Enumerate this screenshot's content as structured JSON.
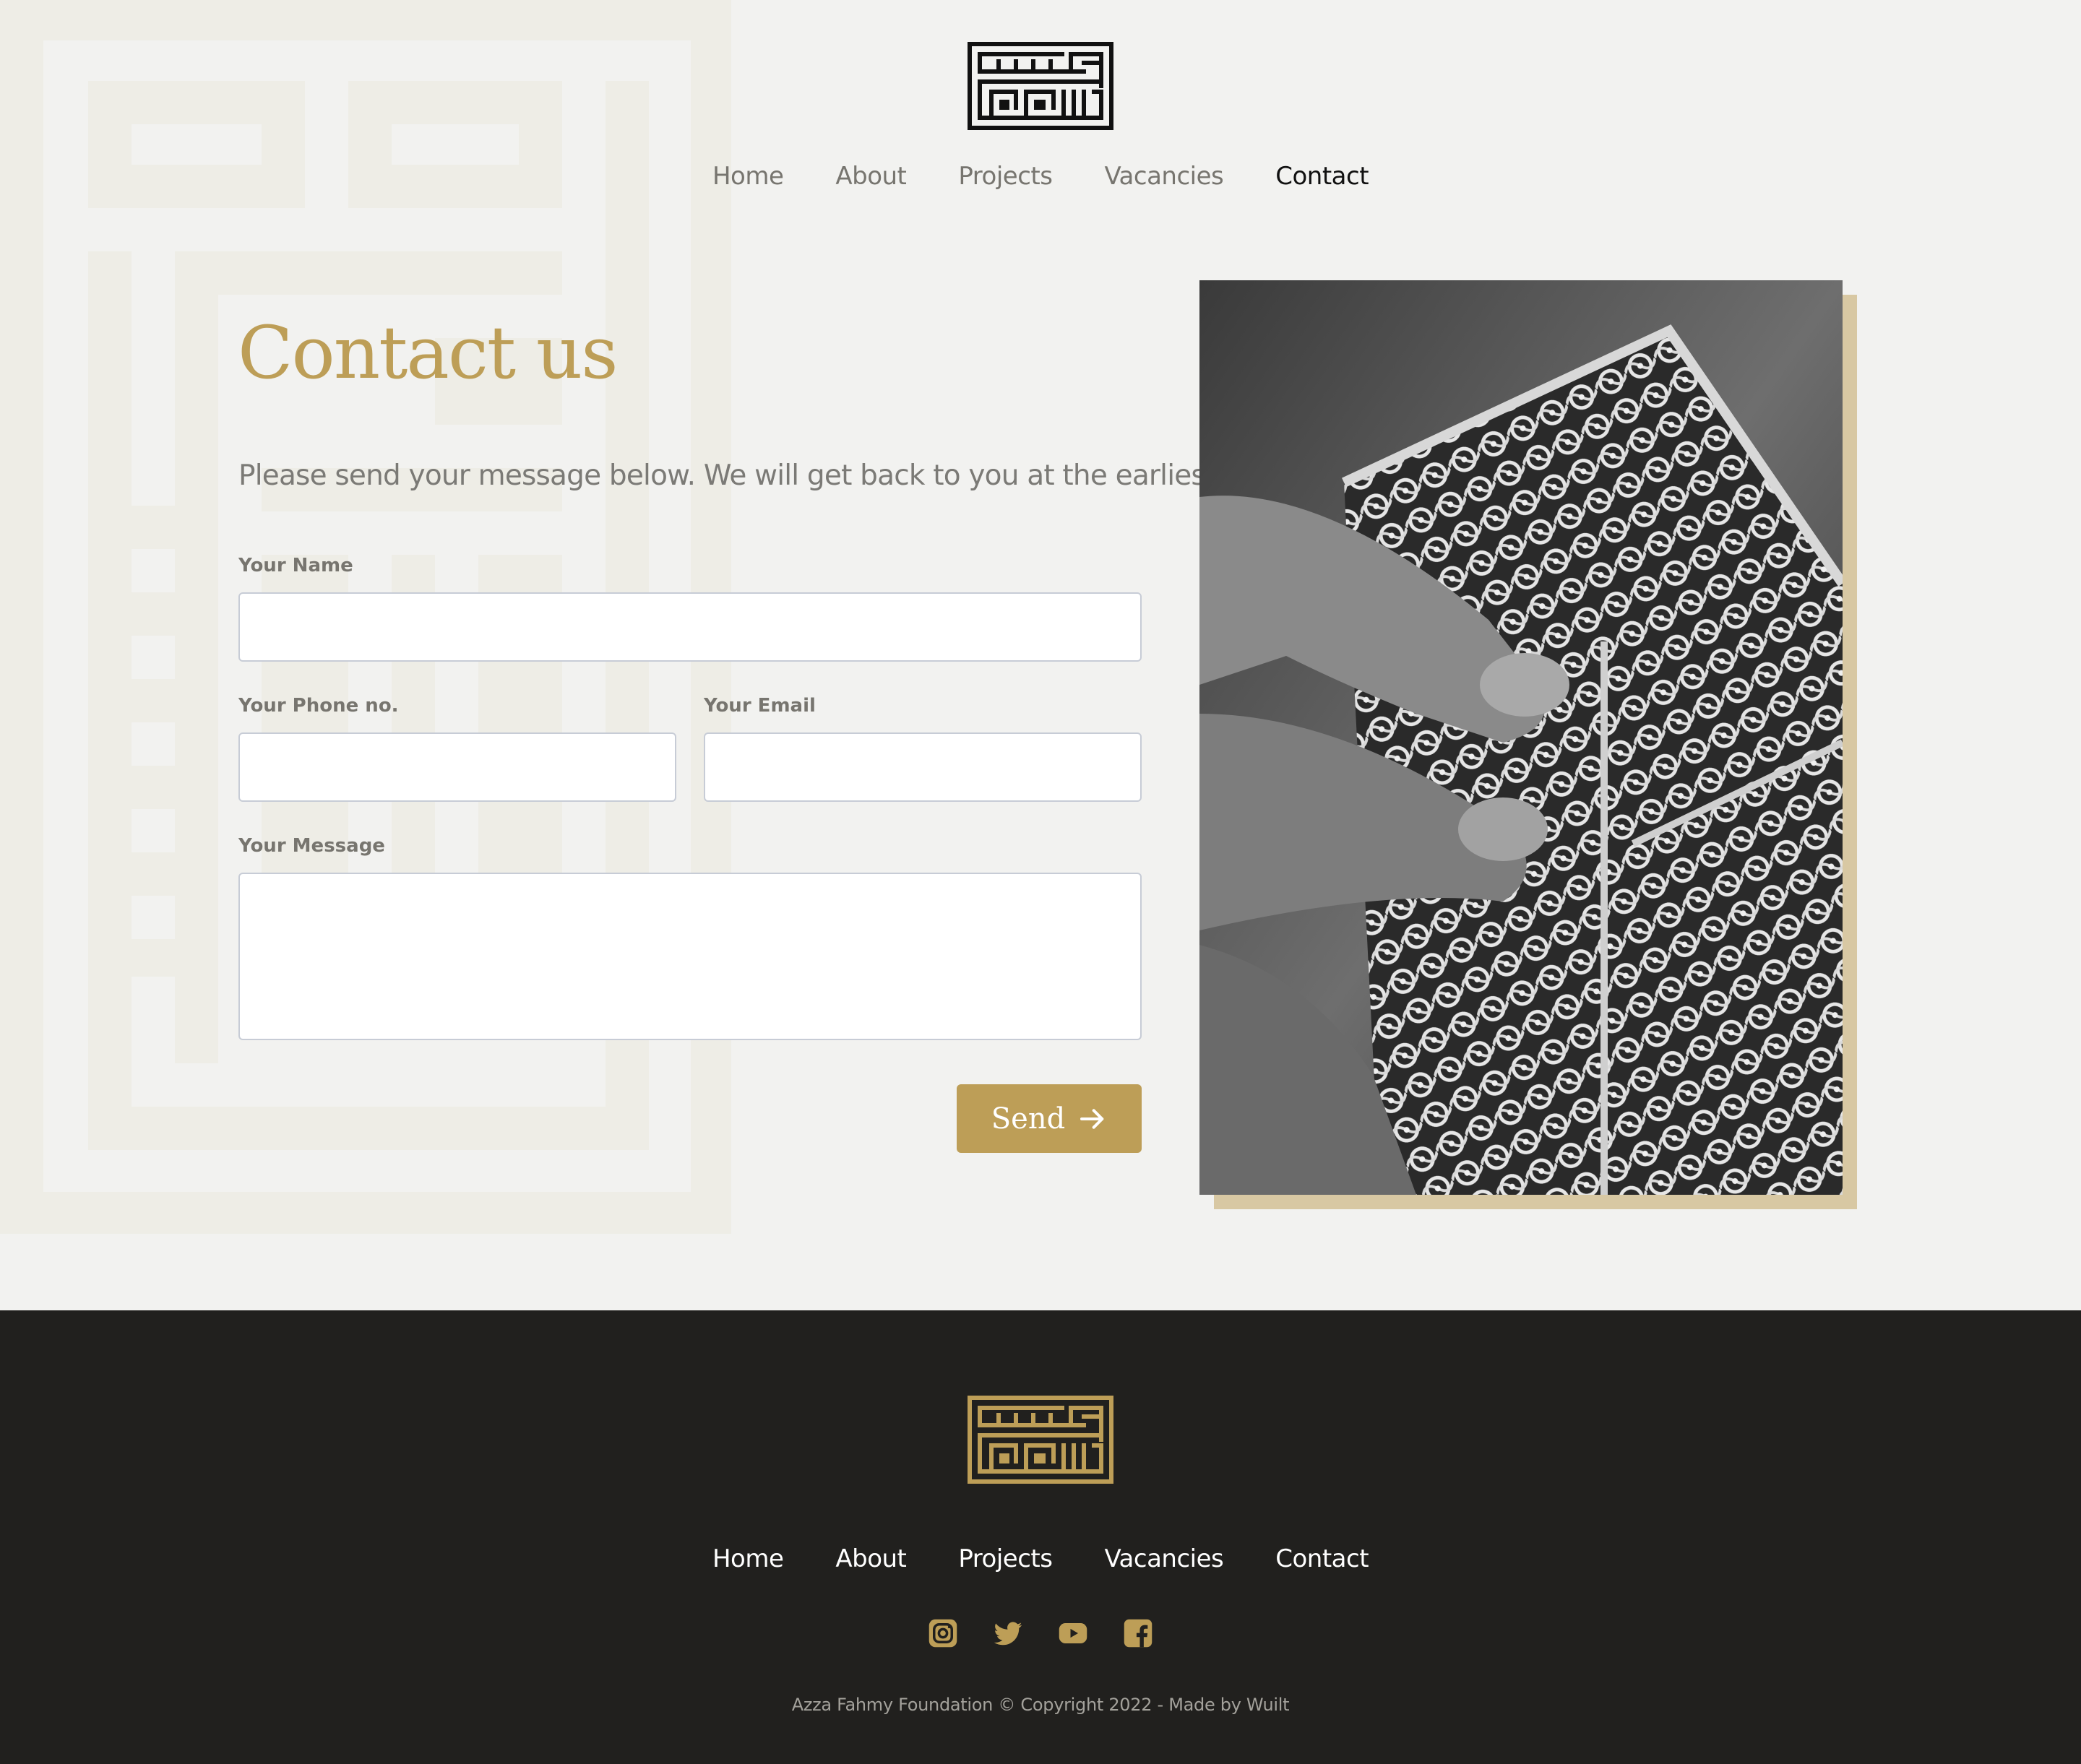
{
  "colors": {
    "accent": "#bd9e57",
    "background": "#f2f2f0",
    "footer": "#21201e"
  },
  "nav": [
    {
      "label": "Home"
    },
    {
      "label": "About"
    },
    {
      "label": "Projects"
    },
    {
      "label": "Vacancies"
    },
    {
      "label": "Contact",
      "active": true
    }
  ],
  "contact": {
    "title": "Contact us",
    "intro": "Please send your message below. We will get back to you at the earliest!",
    "fields": {
      "name": {
        "label": "Your Name",
        "value": ""
      },
      "phone": {
        "label": "Your Phone no.",
        "value": ""
      },
      "email": {
        "label": "Your Email",
        "value": ""
      },
      "message": {
        "label": "Your Message",
        "value": ""
      }
    },
    "send_label": "Send"
  },
  "footer": {
    "nav": [
      {
        "label": "Home"
      },
      {
        "label": "About"
      },
      {
        "label": "Projects"
      },
      {
        "label": "Vacancies"
      },
      {
        "label": "Contact"
      }
    ],
    "social": [
      "instagram-icon",
      "twitter-icon",
      "youtube-icon",
      "facebook-icon"
    ],
    "copyright": "Azza Fahmy Foundation © Copyright 2022 - Made by Wuilt"
  }
}
